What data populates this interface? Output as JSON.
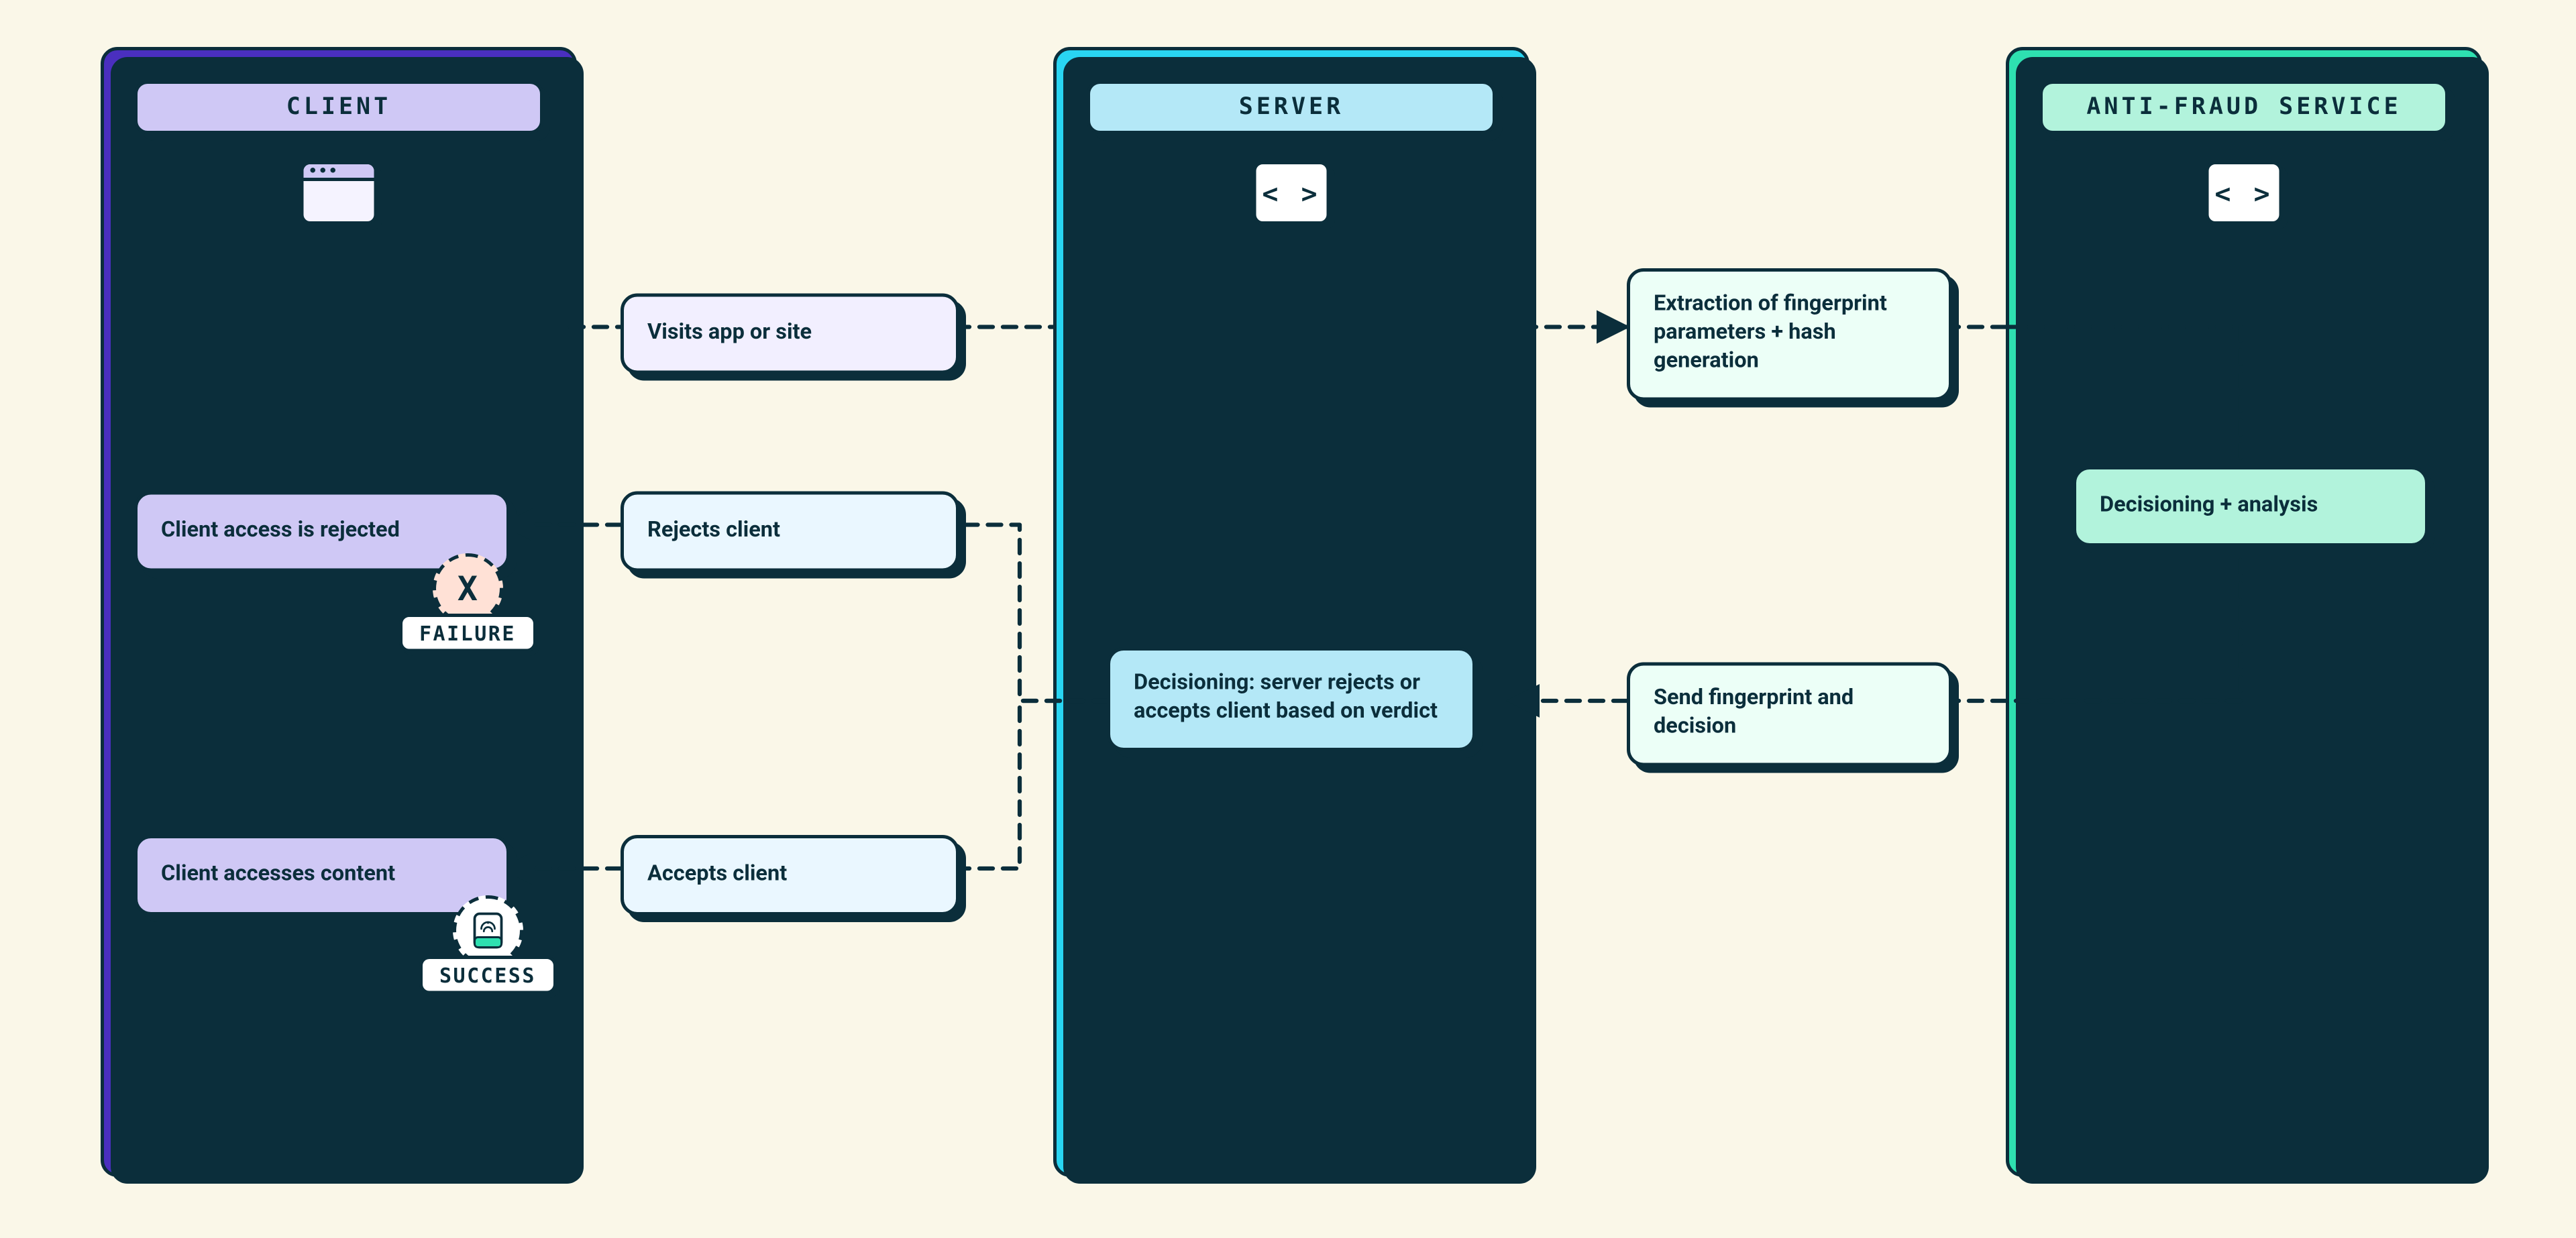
{
  "columns": {
    "client": {
      "title": "CLIENT"
    },
    "server": {
      "title": "SERVER"
    },
    "antifraud": {
      "title": "ANTI-FRAUD SERVICE"
    }
  },
  "steps": {
    "visits": "Visits app or site",
    "extract": "Extraction of fingerprint parameters + hash generation",
    "decisioning": "Decisioning + analysis",
    "send_decision": "Send fingerprint and decision",
    "server_decide": "Decisioning: server rejects or accepts client based on verdict",
    "rejects": "Rejects client",
    "accepts": "Accepts client",
    "rejected": "Client access is rejected",
    "accesses": "Client accesses content"
  },
  "badges": {
    "failure": "FAILURE",
    "success": "SUCCESS"
  }
}
